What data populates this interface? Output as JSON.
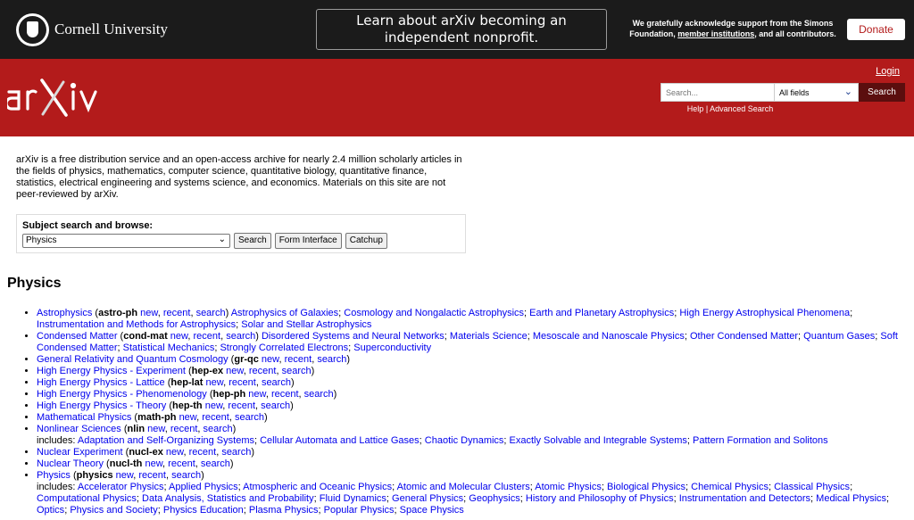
{
  "banner": {
    "university": "Cornell University",
    "announcement_line1": "Learn about arXiv becoming an",
    "announcement_line2": "independent nonprofit.",
    "support_text_a": "We gratefully acknowledge support from the Simons Foundation, ",
    "support_link": "member institutions",
    "support_text_b": ", and all contributors.",
    "donate_label": "Donate"
  },
  "header": {
    "logo_text": "arXiv",
    "login_label": "Login",
    "search_placeholder": "Search...",
    "search_field_value": "All fields",
    "search_button": "Search",
    "help_label": "Help",
    "separator": "|",
    "advanced_label": "Advanced Search"
  },
  "intro": {
    "text": "arXiv is a free distribution service and an open-access archive for nearly 2.4 million scholarly articles in the fields of physics, mathematics, computer science, quantitative biology, quantitative finance, statistics, electrical engineering and systems science, and economics. Materials on this site are not peer-reviewed by arXiv."
  },
  "subject_search": {
    "label": "Subject search and browse:",
    "selected": "Physics",
    "search_button": "Search",
    "form_button": "Form Interface",
    "catchup_button": "Catchup"
  },
  "section": {
    "title": "Physics"
  },
  "links": {
    "new": "new",
    "recent": "recent",
    "search": "search",
    "includes": "includes:"
  },
  "categories": [
    {
      "name": "Astrophysics",
      "code": "astro-ph",
      "subs": [
        "Astrophysics of Galaxies",
        "Cosmology and Nongalactic Astrophysics",
        "Earth and Planetary Astrophysics",
        "High Energy Astrophysical Phenomena",
        "Instrumentation and Methods for Astrophysics",
        "Solar and Stellar Astrophysics"
      ]
    },
    {
      "name": "Condensed Matter",
      "code": "cond-mat",
      "subs": [
        "Disordered Systems and Neural Networks",
        "Materials Science",
        "Mesoscale and Nanoscale Physics",
        "Other Condensed Matter",
        "Quantum Gases",
        "Soft Condensed Matter",
        "Statistical Mechanics",
        "Strongly Correlated Electrons",
        "Superconductivity"
      ]
    },
    {
      "name": "General Relativity and Quantum Cosmology",
      "code": "gr-qc"
    },
    {
      "name": "High Energy Physics - Experiment",
      "code": "hep-ex"
    },
    {
      "name": "High Energy Physics - Lattice",
      "code": "hep-lat"
    },
    {
      "name": "High Energy Physics - Phenomenology",
      "code": "hep-ph"
    },
    {
      "name": "High Energy Physics - Theory",
      "code": "hep-th"
    },
    {
      "name": "Mathematical Physics",
      "code": "math-ph"
    },
    {
      "name": "Nonlinear Sciences",
      "code": "nlin",
      "includes": [
        "Adaptation and Self-Organizing Systems",
        "Cellular Automata and Lattice Gases",
        "Chaotic Dynamics",
        "Exactly Solvable and Integrable Systems",
        "Pattern Formation and Solitons"
      ]
    },
    {
      "name": "Nuclear Experiment",
      "code": "nucl-ex"
    },
    {
      "name": "Nuclear Theory",
      "code": "nucl-th"
    },
    {
      "name": "Physics",
      "code": "physics",
      "includes": [
        "Accelerator Physics",
        "Applied Physics",
        "Atmospheric and Oceanic Physics",
        "Atomic and Molecular Clusters",
        "Atomic Physics",
        "Biological Physics",
        "Chemical Physics",
        "Classical Physics",
        "Computational Physics",
        "Data Analysis, Statistics and Probability",
        "Fluid Dynamics",
        "General Physics",
        "Geophysics",
        "History and Philosophy of Physics",
        "Instrumentation and Detectors",
        "Medical Physics",
        "Optics",
        "Physics and Society",
        "Physics Education",
        "Plasma Physics",
        "Popular Physics",
        "Space Physics"
      ]
    }
  ],
  "colors": {
    "brand_red": "#b31b1b",
    "banner_black": "#1b1b1b",
    "link_blue": "#0000ee"
  }
}
